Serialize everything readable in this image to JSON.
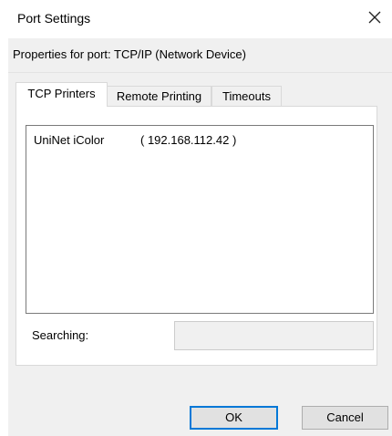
{
  "window": {
    "title": "Port Settings",
    "close_icon": "close-icon"
  },
  "properties_label": "Properties for port: TCP/IP (Network Device)",
  "tabs": [
    {
      "label": "TCP Printers",
      "active": true
    },
    {
      "label": "Remote Printing",
      "active": false
    },
    {
      "label": "Timeouts",
      "active": false
    }
  ],
  "printers": [
    {
      "name": "UniNet iColor",
      "address": "( 192.168.112.42 )"
    }
  ],
  "searching": {
    "label": "Searching:",
    "value": ""
  },
  "buttons": {
    "ok": "OK",
    "cancel": "Cancel"
  },
  "colors": {
    "accent": "#0078d7",
    "client_bg": "#f0f0f0"
  }
}
